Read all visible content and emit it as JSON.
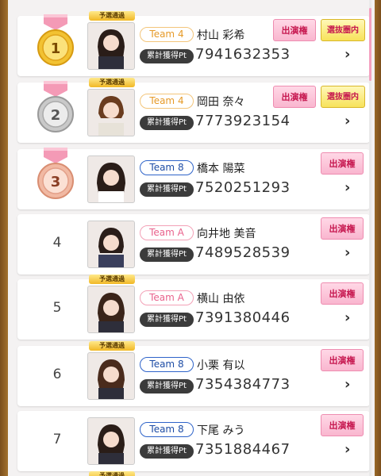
{
  "list": {
    "pt_label": "累計獲得Pt",
    "yosen_badge": "予選通過",
    "shutsuen_label": "出演権",
    "senbatsu_label": "選抜圏内",
    "chevron": "›",
    "rows": [
      {
        "rank": "1",
        "team": "Team 4",
        "name": "村山 彩希",
        "pt": "7941632353"
      },
      {
        "rank": "2",
        "team": "Team 4",
        "name": "岡田 奈々",
        "pt": "7773923154"
      },
      {
        "rank": "3",
        "team": "Team 8",
        "name": "橋本 陽菜",
        "pt": "7520251293"
      },
      {
        "rank": "4",
        "team": "Team A",
        "name": "向井地 美音",
        "pt": "7489528539"
      },
      {
        "rank": "5",
        "team": "Team A",
        "name": "横山 由依",
        "pt": "7391380446"
      },
      {
        "rank": "6",
        "team": "Team 8",
        "name": "小栗 有以",
        "pt": "7354384773"
      },
      {
        "rank": "7",
        "team": "Team 8",
        "name": "下尾 みう",
        "pt": "7351884467"
      }
    ]
  },
  "colors": {
    "gold": "#f2c232",
    "silver": "#c9c9c9",
    "bronze": "#f1b9a3",
    "ribbon": "#f49ab6",
    "accent_pink": "#e9628c",
    "team8_blue": "#1d4ca5"
  }
}
